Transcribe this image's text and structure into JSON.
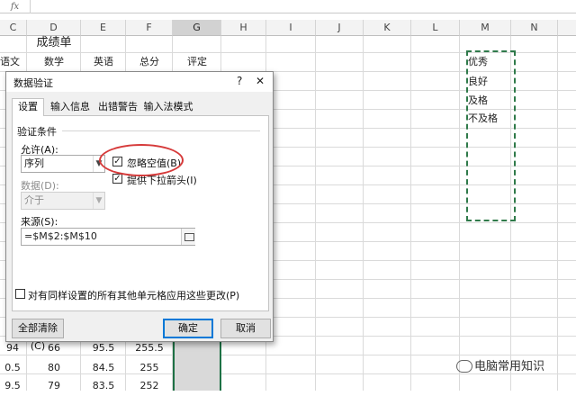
{
  "formula_bar": {
    "fx_label": "fx",
    "value": ""
  },
  "columns": [
    {
      "label": "C",
      "selected": false
    },
    {
      "label": "D",
      "selected": false
    },
    {
      "label": "E",
      "selected": false
    },
    {
      "label": "F",
      "selected": false
    },
    {
      "label": "G",
      "selected": true
    },
    {
      "label": "H",
      "selected": false
    },
    {
      "label": "I",
      "selected": false
    },
    {
      "label": "J",
      "selected": false
    },
    {
      "label": "K",
      "selected": false
    },
    {
      "label": "L",
      "selected": false
    },
    {
      "label": "M",
      "selected": false
    },
    {
      "label": "N",
      "selected": false
    }
  ],
  "sheet": {
    "title": "成绩单",
    "headers": [
      "语文",
      "数学",
      "英语",
      "总分",
      "评定"
    ],
    "visible_rows": [
      [
        "94",
        "66",
        "95.5",
        "255.5",
        ""
      ],
      [
        "0.5",
        "80",
        "84.5",
        "255",
        ""
      ],
      [
        "9.5",
        "79",
        "83.5",
        "252",
        ""
      ]
    ],
    "list_values": [
      "优秀",
      "良好",
      "及格",
      "不及格"
    ]
  },
  "dialog": {
    "title": "数据验证",
    "help": "?",
    "close": "✕",
    "tabs": [
      "设置",
      "输入信息",
      "出错警告",
      "输入法模式"
    ],
    "active_tab": 0,
    "section": "验证条件",
    "allow_label": "允许(A):",
    "allow_value": "序列",
    "data_label": "数据(D):",
    "data_value": "介于",
    "ignore_blank_label": "忽略空值(B)",
    "ignore_blank_checked": true,
    "dropdown_label": "提供下拉箭头(I)",
    "dropdown_checked": true,
    "source_label": "来源(S):",
    "source_value": "=$M$2:$M$10",
    "apply_all_label": "对有同样设置的所有其他单元格应用这些更改(P)",
    "apply_all_checked": false,
    "clear_all": "全部清除(C)",
    "ok": "确定",
    "cancel": "取消"
  },
  "watermark": "电脑常用知识",
  "colors": {
    "selection_border": "#2f7a4a",
    "highlight_oval": "#d63a3a",
    "ok_border": "#0078d7"
  }
}
